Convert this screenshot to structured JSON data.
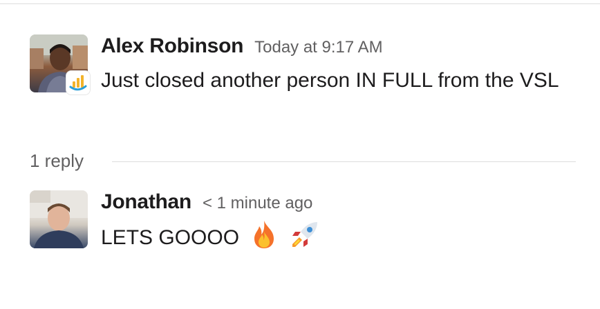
{
  "messages": [
    {
      "author": "Alex Robinson",
      "timestamp": "Today at 9:17 AM",
      "text": "Just closed another person IN FULL from the VSL",
      "avatar_icon": "user-avatar-photo",
      "badge_icon": "bar-chart-app-icon"
    },
    {
      "author": "Jonathan",
      "timestamp": "< 1 minute ago",
      "text": "LETS GOOOO",
      "avatar_icon": "user-avatar-photo",
      "emojis": [
        "fire-emoji",
        "rocket-emoji"
      ]
    }
  ],
  "thread": {
    "reply_count": "1 reply"
  },
  "colors": {
    "text": "#1d1c1d",
    "muted": "#616061",
    "divider": "#dcdcdc"
  }
}
